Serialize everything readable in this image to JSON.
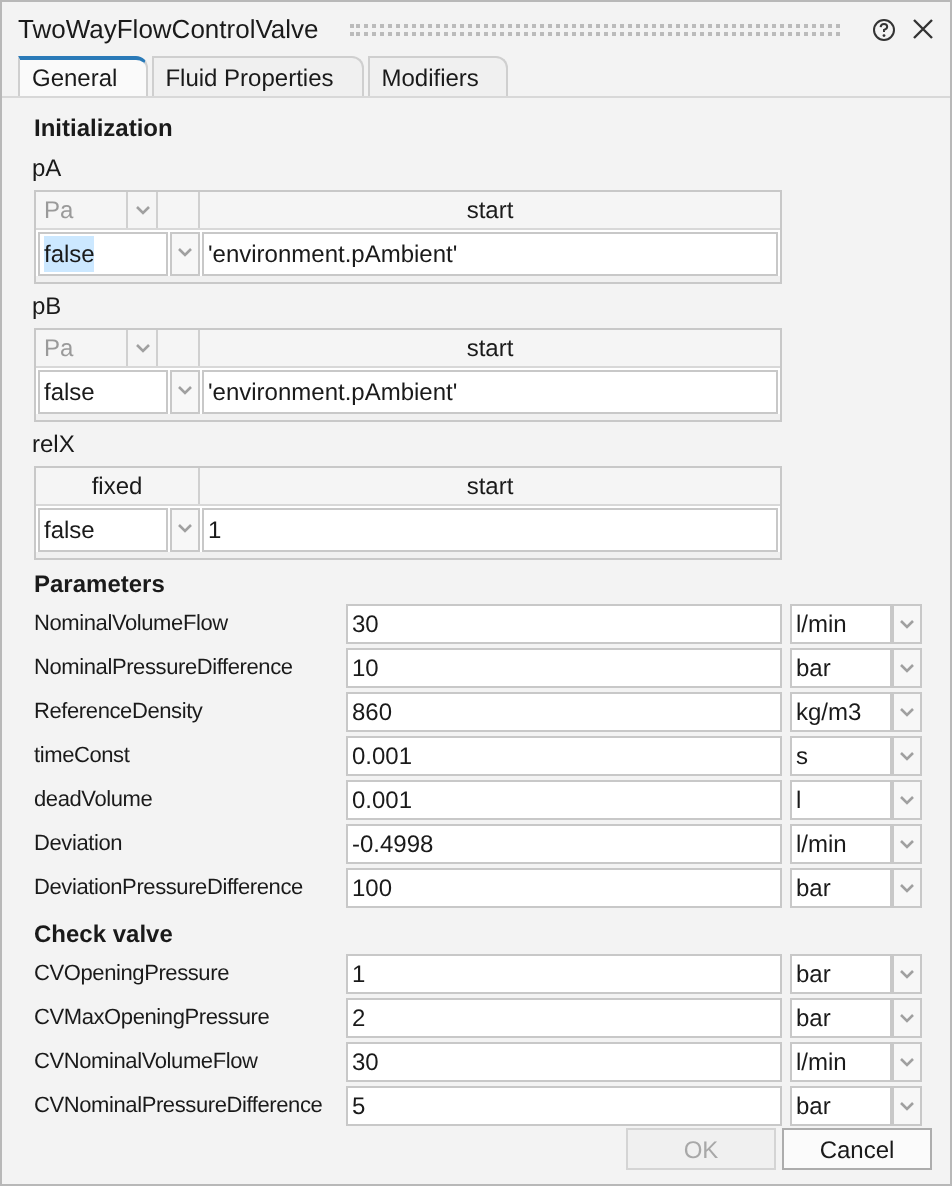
{
  "window": {
    "title": "TwoWayFlowControlValve"
  },
  "tabs": [
    {
      "label": "General",
      "selected": true
    },
    {
      "label": "Fluid Properties",
      "selected": false
    },
    {
      "label": "Modifiers",
      "selected": false
    }
  ],
  "initialization": {
    "heading": "Initialization",
    "variables": [
      {
        "name": "pA",
        "kind": "unit_selector",
        "unit": "Pa",
        "start_header": "start",
        "fixed": "false",
        "highlighted": true,
        "start": "'environment.pAmbient'"
      },
      {
        "name": "pB",
        "kind": "unit_selector",
        "unit": "Pa",
        "start_header": "start",
        "fixed": "false",
        "highlighted": false,
        "start": "'environment.pAmbient'"
      },
      {
        "name": "relX",
        "kind": "column_title",
        "fixed_header": "fixed",
        "start_header": "start",
        "fixed": "false",
        "highlighted": false,
        "start": "1"
      }
    ]
  },
  "sections": [
    {
      "heading": "Parameters",
      "rows": [
        {
          "label": "NominalVolumeFlow",
          "value": "30",
          "unit": "l/min"
        },
        {
          "label": "NominalPressureDifference",
          "value": "10",
          "unit": "bar"
        },
        {
          "label": "ReferenceDensity",
          "value": "860",
          "unit": "kg/m3"
        },
        {
          "label": "timeConst",
          "value": "0.001",
          "unit": "s"
        },
        {
          "label": "deadVolume",
          "value": "0.001",
          "unit": "l"
        },
        {
          "label": "Deviation",
          "value": "-0.4998",
          "unit": "l/min"
        },
        {
          "label": "DeviationPressureDifference",
          "value": "100",
          "unit": "bar"
        }
      ]
    },
    {
      "heading": "Check valve",
      "rows": [
        {
          "label": "CVOpeningPressure",
          "value": "1",
          "unit": "bar"
        },
        {
          "label": "CVMaxOpeningPressure",
          "value": "2",
          "unit": "bar"
        },
        {
          "label": "CVNominalVolumeFlow",
          "value": "30",
          "unit": "l/min"
        },
        {
          "label": "CVNominalPressureDifference",
          "value": "5",
          "unit": "bar"
        }
      ]
    }
  ],
  "buttons": [
    {
      "label": "OK",
      "disabled": true
    },
    {
      "label": "Cancel",
      "disabled": false
    }
  ]
}
